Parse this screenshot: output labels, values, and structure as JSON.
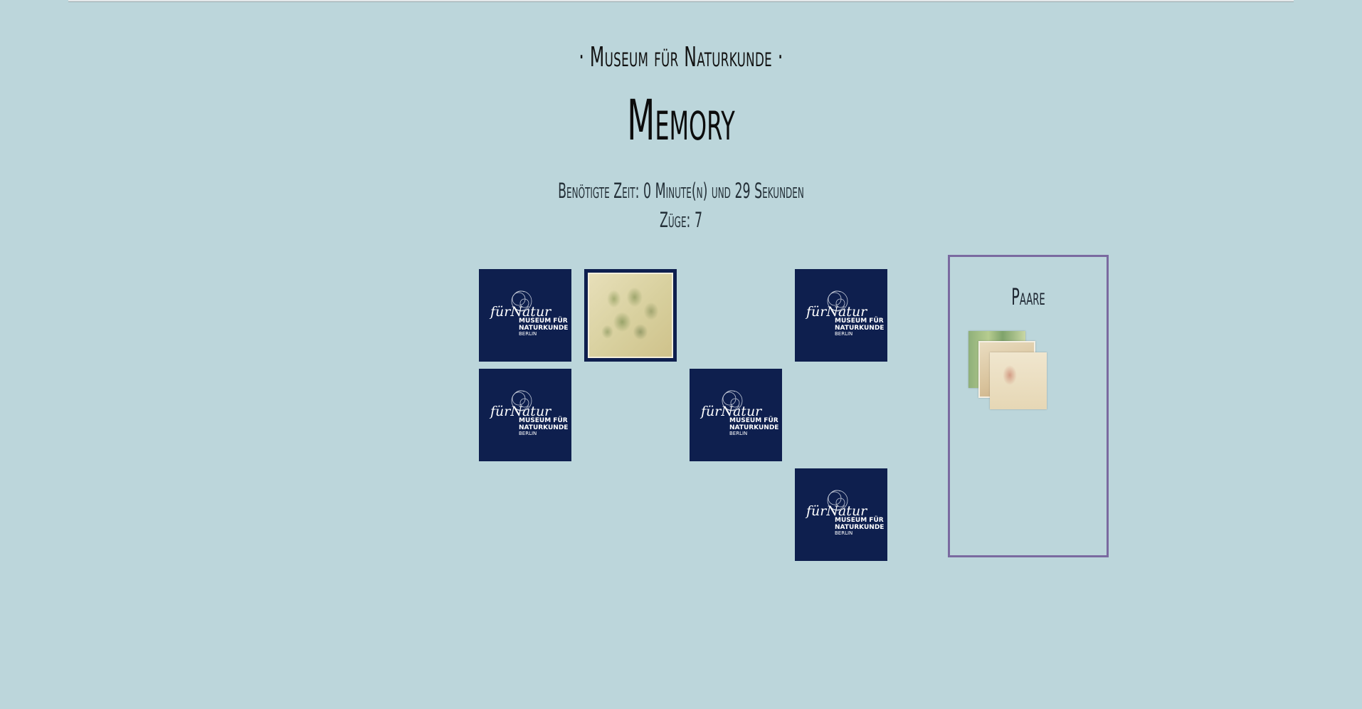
{
  "header": {
    "subtitle": "· Museum für Naturkunde ·",
    "title": "Memory"
  },
  "stats": {
    "time": "Benötigte Zeit: 0 Minute(n) und 29 Sekunden",
    "moves": "Züge: 7"
  },
  "board": {
    "card_logo_text": {
      "script": "fürNatur",
      "line1": "MUSEUM FÜR",
      "line2": "NATURKUNDE",
      "line3": "BERLIN"
    },
    "cards": [
      {
        "state": "face-down"
      },
      {
        "state": "face-up",
        "image": "herbarium-leaves"
      },
      {
        "state": "face-down"
      },
      {
        "state": "face-down"
      },
      {
        "state": "face-down"
      },
      {
        "state": "face-down"
      }
    ]
  },
  "pairs": {
    "title": "Paare",
    "found_images": [
      "green-plant-illustration",
      "beige-sketch",
      "jellyfish-drawing"
    ]
  },
  "colors": {
    "background": "#bcd6db",
    "card_back": "#0e1f4e",
    "panel_border": "#7a6aa0"
  }
}
